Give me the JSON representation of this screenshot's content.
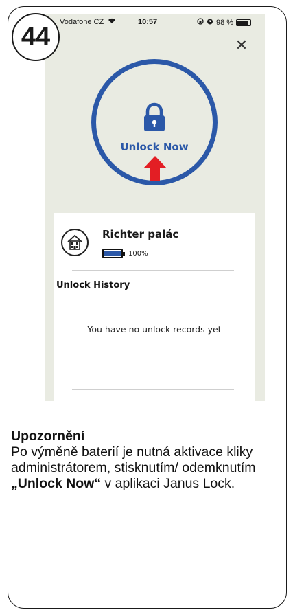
{
  "step": {
    "number": "44"
  },
  "status_bar": {
    "carrier": "Vodafone CZ",
    "time": "10:57",
    "battery_percent": "98 %"
  },
  "unlock": {
    "label": "Unlock Now",
    "accent_color": "#2b58a8",
    "arrow_color": "#e31e24"
  },
  "device": {
    "name": "Richter palác",
    "battery_level": "100%",
    "icon": "house-icon"
  },
  "history": {
    "title": "Unlock History",
    "empty_message": "You have no unlock records yet"
  },
  "note": {
    "title": "Upozornění",
    "text_before": "Po výměně baterií je nutná aktivace kliky administrátorem, stisknutím/ odemknutím ",
    "highlight": "„Unlock Now“",
    "text_after": " v aplikaci Janus Lock."
  }
}
